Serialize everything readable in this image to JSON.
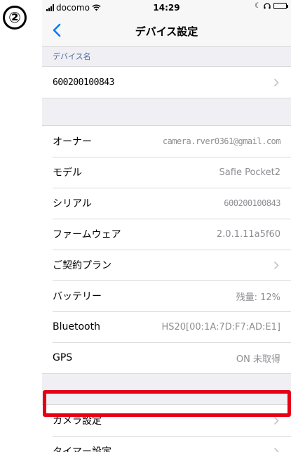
{
  "step_marker": "②",
  "status_bar": {
    "carrier": "docomo",
    "time": "14:29"
  },
  "nav": {
    "title": "デバイス設定"
  },
  "device_section": {
    "header": "デバイス名",
    "device_name": "600200100843"
  },
  "info_rows": [
    {
      "label": "オーナー",
      "value": "camera.rver0361@gmail.com"
    },
    {
      "label": "モデル",
      "value": "Safie Pocket2"
    },
    {
      "label": "シリアル",
      "value": "600200100843"
    },
    {
      "label": "ファームウェア",
      "value": "2.0.1.11a5f60"
    },
    {
      "label": "ご契約プラン",
      "value": ""
    },
    {
      "label": "バッテリー",
      "value": "残量: 12%"
    },
    {
      "label": "Bluetooth",
      "value": "HS20[00:1A:7D:F7:AD:E1]"
    },
    {
      "label": "GPS",
      "value": "ON 未取得"
    }
  ],
  "settings_rows": [
    {
      "label": "カメラ設定"
    },
    {
      "label": "タイマー設定"
    }
  ],
  "colors": {
    "highlight": "#e60012",
    "link": "#007aff"
  }
}
